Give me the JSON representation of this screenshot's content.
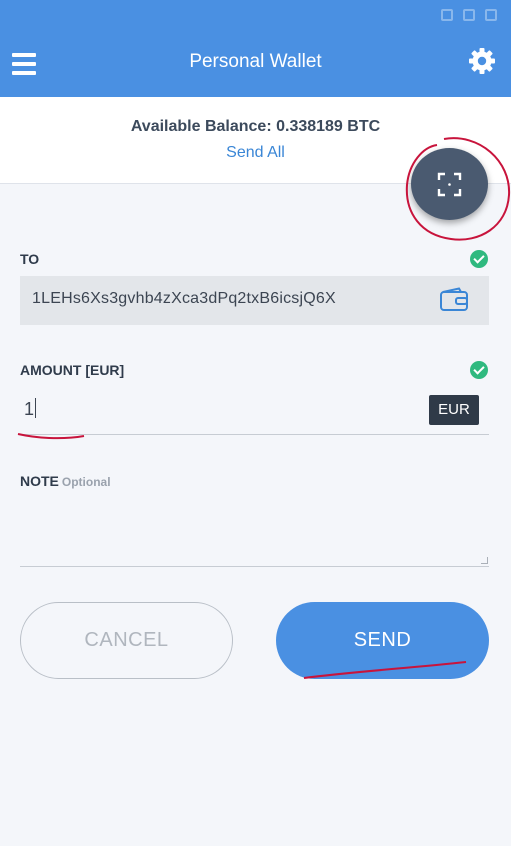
{
  "header": {
    "title": "Personal Wallet"
  },
  "balance": {
    "text": "Available Balance: 0.338189 BTC",
    "send_all_label": "Send All"
  },
  "to": {
    "label": "TO",
    "address": "1LEHs6Xs3gvhb4zXca3dPq2txB6icsjQ6X"
  },
  "amount": {
    "label": "AMOUNT [EUR]",
    "value": "1",
    "currency": "EUR"
  },
  "note": {
    "label": "NOTE",
    "optional": "Optional"
  },
  "buttons": {
    "cancel": "CANCEL",
    "send": "SEND"
  },
  "colors": {
    "primary": "#4a90e2",
    "fab": "#4a5a70",
    "success": "#2fb97f",
    "annotation": "#c8143c"
  },
  "icons": [
    "menu-icon",
    "settings-icon",
    "qr-scan-icon",
    "check-icon",
    "wallet-icon"
  ]
}
